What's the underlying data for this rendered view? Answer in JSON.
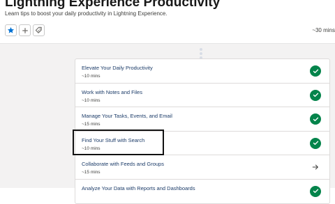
{
  "header": {
    "title": "Lightning Experience Productivity",
    "subtitle": "Learn tips to boost your daily productivity in Lightning Experience.",
    "duration": "~30 mins"
  },
  "actions": [
    {
      "icon": "star-icon",
      "label": "favorite"
    },
    {
      "icon": "plus-icon",
      "label": "add"
    },
    {
      "icon": "tag-icon",
      "label": "tag"
    }
  ],
  "units": [
    {
      "title": "Elevate Your Daily Productivity",
      "time": "~10 mins",
      "status": "completed"
    },
    {
      "title": "Work with Notes and Files",
      "time": "~10 mins",
      "status": "completed"
    },
    {
      "title": "Manage Your Tasks, Events, and Email",
      "time": "~15 mins",
      "status": "completed"
    },
    {
      "title": "Find Your Stuff with Search",
      "time": "~10 mins",
      "status": "completed"
    },
    {
      "title": "Collaborate with Feeds and Groups",
      "time": "~15 mins",
      "status": "not-started"
    },
    {
      "title": "Analyze Your Data with Reports and Dashboards",
      "time": "",
      "status": "completed"
    }
  ],
  "colors": {
    "accent": "#0070d2",
    "completed": "#04844b",
    "title": "#1b3b68"
  }
}
